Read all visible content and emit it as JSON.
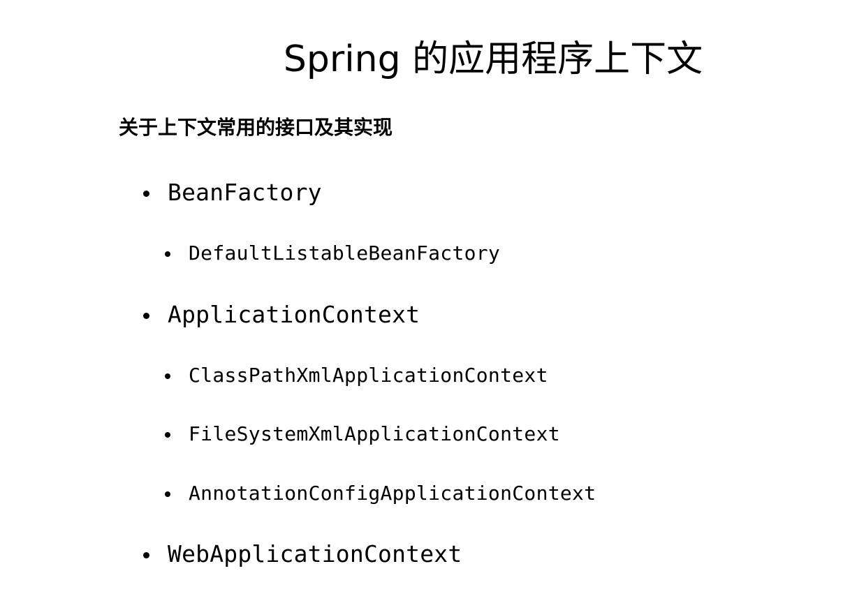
{
  "slide": {
    "title": "Spring 的应用程序上下文",
    "subtitle": "关于上下文常用的接口及其实现"
  },
  "items": [
    {
      "label": "BeanFactory",
      "level": 1
    },
    {
      "label": "DefaultListableBeanFactory",
      "level": 2
    },
    {
      "label": "ApplicationContext",
      "level": 1
    },
    {
      "label": "ClassPathXmlApplicationContext",
      "level": 2
    },
    {
      "label": "FileSystemXmlApplicationContext",
      "level": 2
    },
    {
      "label": "AnnotationConfigApplicationContext",
      "level": 2
    },
    {
      "label": "WebApplicationContext",
      "level": 1
    }
  ]
}
